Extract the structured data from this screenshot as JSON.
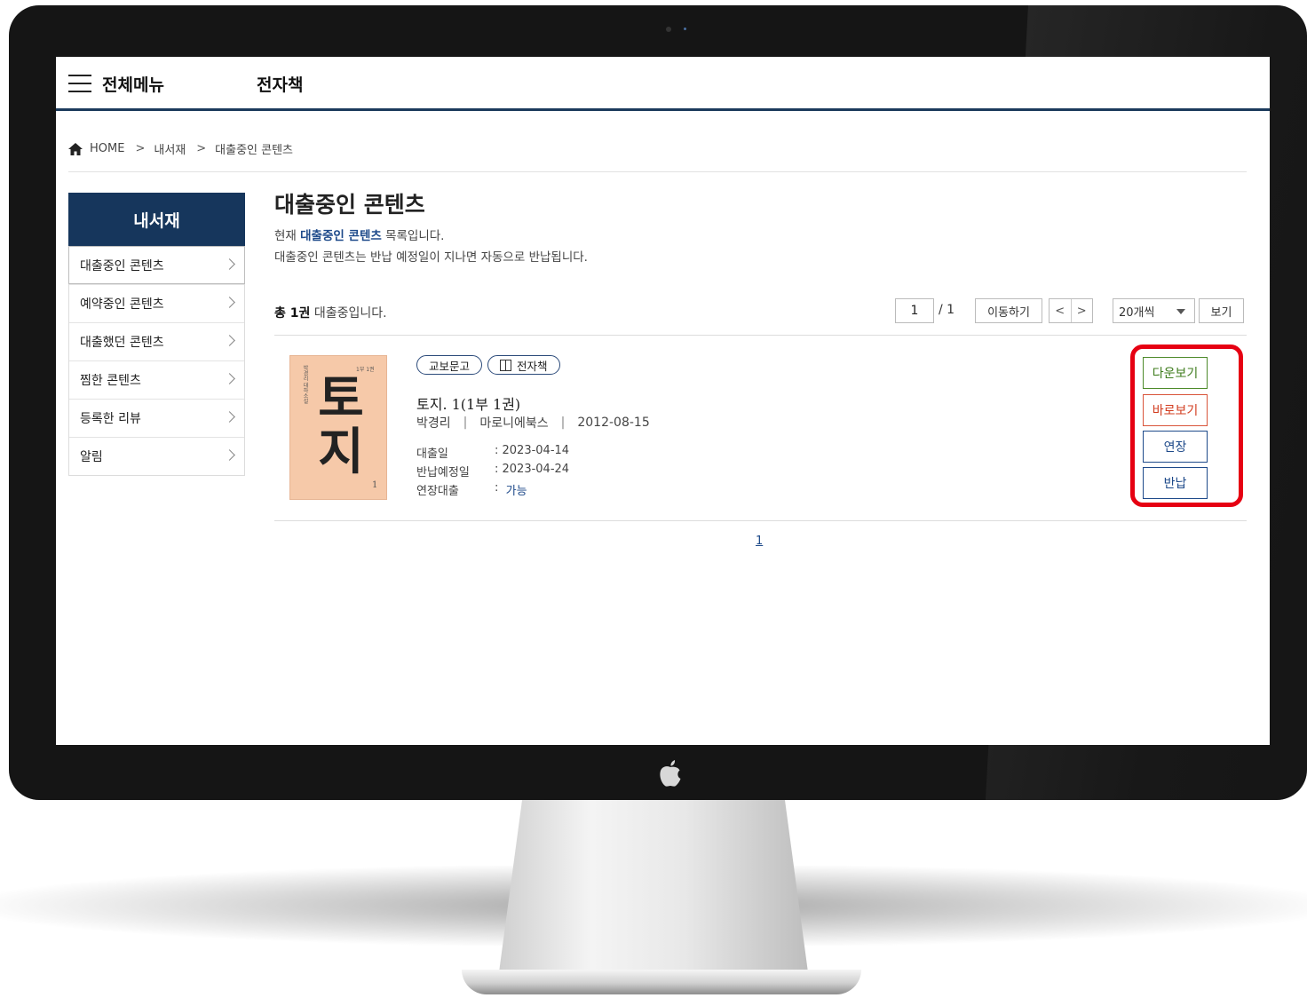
{
  "header": {
    "menu_label": "전체메뉴",
    "section_title": "전자책"
  },
  "breadcrumb": {
    "home": "HOME",
    "sep": ">",
    "level1": "내서재",
    "level2": "대출중인 콘텐츠"
  },
  "sidebar": {
    "title": "내서재",
    "items": [
      {
        "label": "대출중인 콘텐츠"
      },
      {
        "label": "예약중인 콘텐츠"
      },
      {
        "label": "대출했던 콘텐츠"
      },
      {
        "label": "찜한 콘텐츠"
      },
      {
        "label": "등록한 리뷰"
      },
      {
        "label": "알림"
      }
    ]
  },
  "main": {
    "title": "대출중인 콘텐츠",
    "desc_prefix": "현재 ",
    "desc_emphasis": "대출중인 콘텐츠",
    "desc_suffix": " 목록입니다.",
    "desc_line2": "대출중인 콘텐츠는 반납 예정일이 지나면 자동으로 반납됩니다.",
    "total_bold": "총 1권",
    "total_text": " 대출중입니다.",
    "page_current": "1",
    "page_total": "/ 1",
    "move_button": "이동하기",
    "prev": "<",
    "next": ">",
    "per_page": "20개씩",
    "view_button": "보기",
    "pager_page": "1"
  },
  "item": {
    "cover_text": "토지",
    "cover_char1": "토",
    "cover_char2": "지",
    "cover_vol": "1",
    "tag_publisher": "교보문고",
    "tag_type": "전자책",
    "title": "토지. 1(1부 1권)",
    "author": "박경리",
    "publisher": "마로니에북스",
    "date": "2012-08-15",
    "meta_sep": "|",
    "loan_date_label": "대출일",
    "loan_date": ":  2023-04-14",
    "return_label": "반납예정일",
    "return_date": ":  2023-04-24",
    "extend_label": "연장대출",
    "extend_colon": ":  ",
    "extend_value": "가능",
    "actions": {
      "download": "다운보기",
      "direct": "바로보기",
      "extend": "연장",
      "return": "반납"
    }
  },
  "colors": {
    "navy": "#16365c",
    "highlight_frame": "#e60012",
    "download": "#3f7d1e",
    "direct": "#d23c1f",
    "link": "#1e4a8a"
  }
}
